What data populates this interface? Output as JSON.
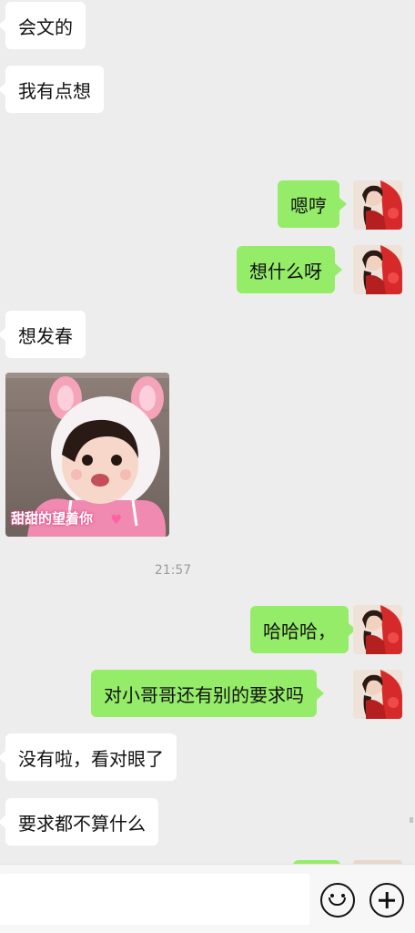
{
  "messages": [
    {
      "side": "left",
      "text": "会文的"
    },
    {
      "side": "left",
      "text": "我有点想"
    },
    {
      "side": "right",
      "text": "嗯哼"
    },
    {
      "side": "right",
      "text": "想什么呀"
    },
    {
      "side": "left",
      "text": "想发春"
    },
    {
      "side": "left",
      "sticker_caption": "甜甜的望着你"
    },
    {
      "side": "right",
      "text": "哈哈哈，"
    },
    {
      "side": "right",
      "text": "对小哥哥还有别的要求吗"
    },
    {
      "side": "left",
      "text": "没有啦，看对眼了"
    },
    {
      "side": "left",
      "text": "要求都不算什么"
    }
  ],
  "timestamp": "21:57",
  "input_bar": {
    "emoji_icon": "smiley-face-icon",
    "plus_icon": "plus-circle-icon"
  },
  "colors": {
    "background": "#ededed",
    "left_bubble": "#ffffff",
    "right_bubble": "#95ec69"
  }
}
